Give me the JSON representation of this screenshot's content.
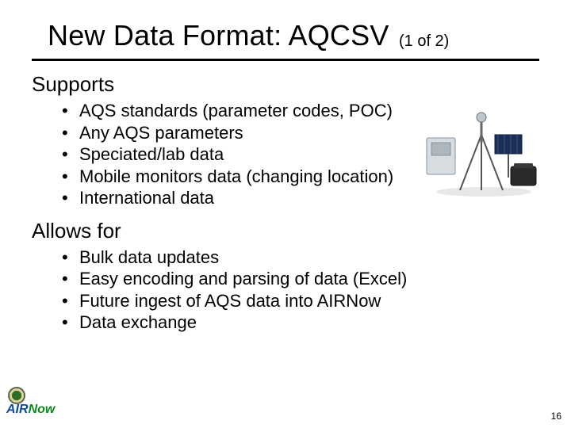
{
  "title": "New Data Format:  AQCSV",
  "pager": "(1 of 2)",
  "sections": {
    "supports": {
      "heading": "Supports",
      "items": [
        "AQS standards (parameter codes, POC)",
        "Any AQS parameters",
        "Speciated/lab data",
        "Mobile monitors data (changing location)",
        "International data"
      ]
    },
    "allows": {
      "heading": "Allows for",
      "items": [
        "Bulk data updates",
        "Easy encoding and parsing of data (Excel)",
        "Future ingest of AQS data into AIRNow",
        "Data exchange"
      ]
    }
  },
  "logo": {
    "air": "AIR",
    "now": "Now"
  },
  "page_number": "16",
  "equipment_alt": "Air quality monitoring equipment on tripod with solar panel and instrument case"
}
